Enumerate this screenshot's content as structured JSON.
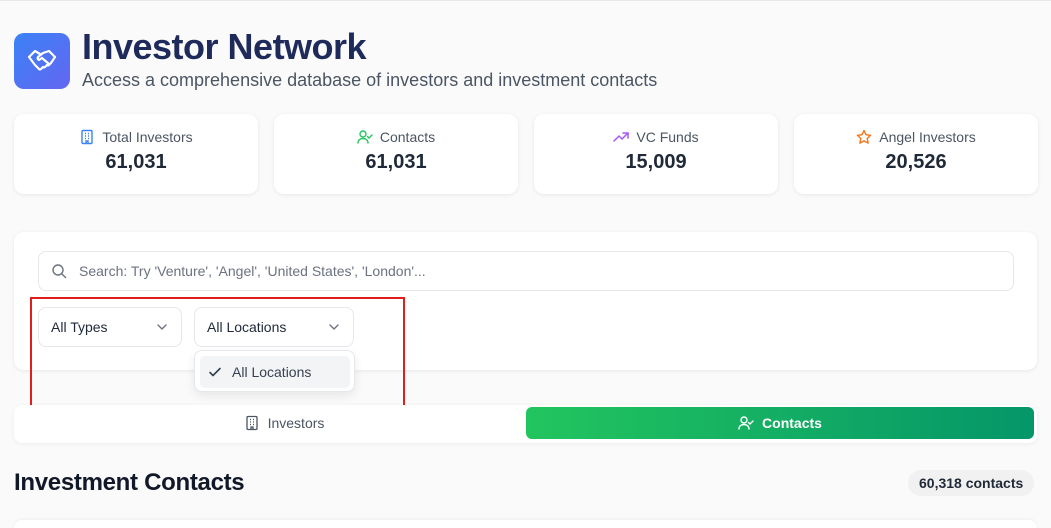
{
  "header": {
    "title": "Investor Network",
    "subtitle": "Access a comprehensive database of investors and investment contacts",
    "logo_icon": "handshake-icon"
  },
  "stats": [
    {
      "label": "Total Investors",
      "value": "61,031",
      "icon": "building-icon",
      "icon_color": "#3b82f6"
    },
    {
      "label": "Contacts",
      "value": "61,031",
      "icon": "user-check-icon",
      "icon_color": "#22c55e"
    },
    {
      "label": "VC Funds",
      "value": "15,009",
      "icon": "trending-up-icon",
      "icon_color": "#a855f7"
    },
    {
      "label": "Angel Investors",
      "value": "20,526",
      "icon": "star-icon",
      "icon_color": "#f97316"
    }
  ],
  "search": {
    "placeholder": "Search: Try 'Venture', 'Angel', 'United States', 'London'...",
    "value": ""
  },
  "filters": {
    "type_select": {
      "selected": "All Types"
    },
    "location_select": {
      "selected": "All Locations",
      "open": true,
      "options": [
        "All Locations"
      ]
    }
  },
  "tabs": [
    {
      "label": "Investors",
      "icon": "building-icon",
      "active": false
    },
    {
      "label": "Contacts",
      "icon": "user-check-icon",
      "active": true
    }
  ],
  "section": {
    "title": "Investment Contacts",
    "count": "60,318 contacts"
  },
  "colors": {
    "brand_gradient_start": "#3b82f6",
    "brand_gradient_end": "#6366f1",
    "active_tab_start": "#22c55e",
    "active_tab_end": "#059669",
    "highlight_border": "#e11d1d"
  }
}
